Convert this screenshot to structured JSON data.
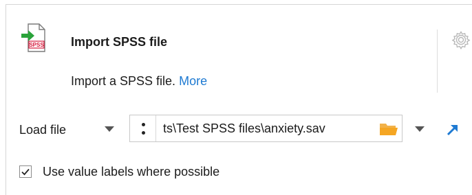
{
  "header": {
    "title": "Import SPSS file",
    "icon": "spss-file-import-icon",
    "icon_badge": "SPSS",
    "description": "Import a SPSS file.",
    "more_link": "More"
  },
  "load": {
    "label": "Load file",
    "path": "ts\\Test SPSS files\\anxiety.sav"
  },
  "options": {
    "use_value_labels": {
      "label": "Use value labels where possible",
      "checked": true
    }
  },
  "colors": {
    "link": "#1e7ad2",
    "accent_arrow": "#1e7ad2",
    "folder": "#f5a623",
    "spss_red": "#d61a3c",
    "import_green": "#2aa33a"
  }
}
